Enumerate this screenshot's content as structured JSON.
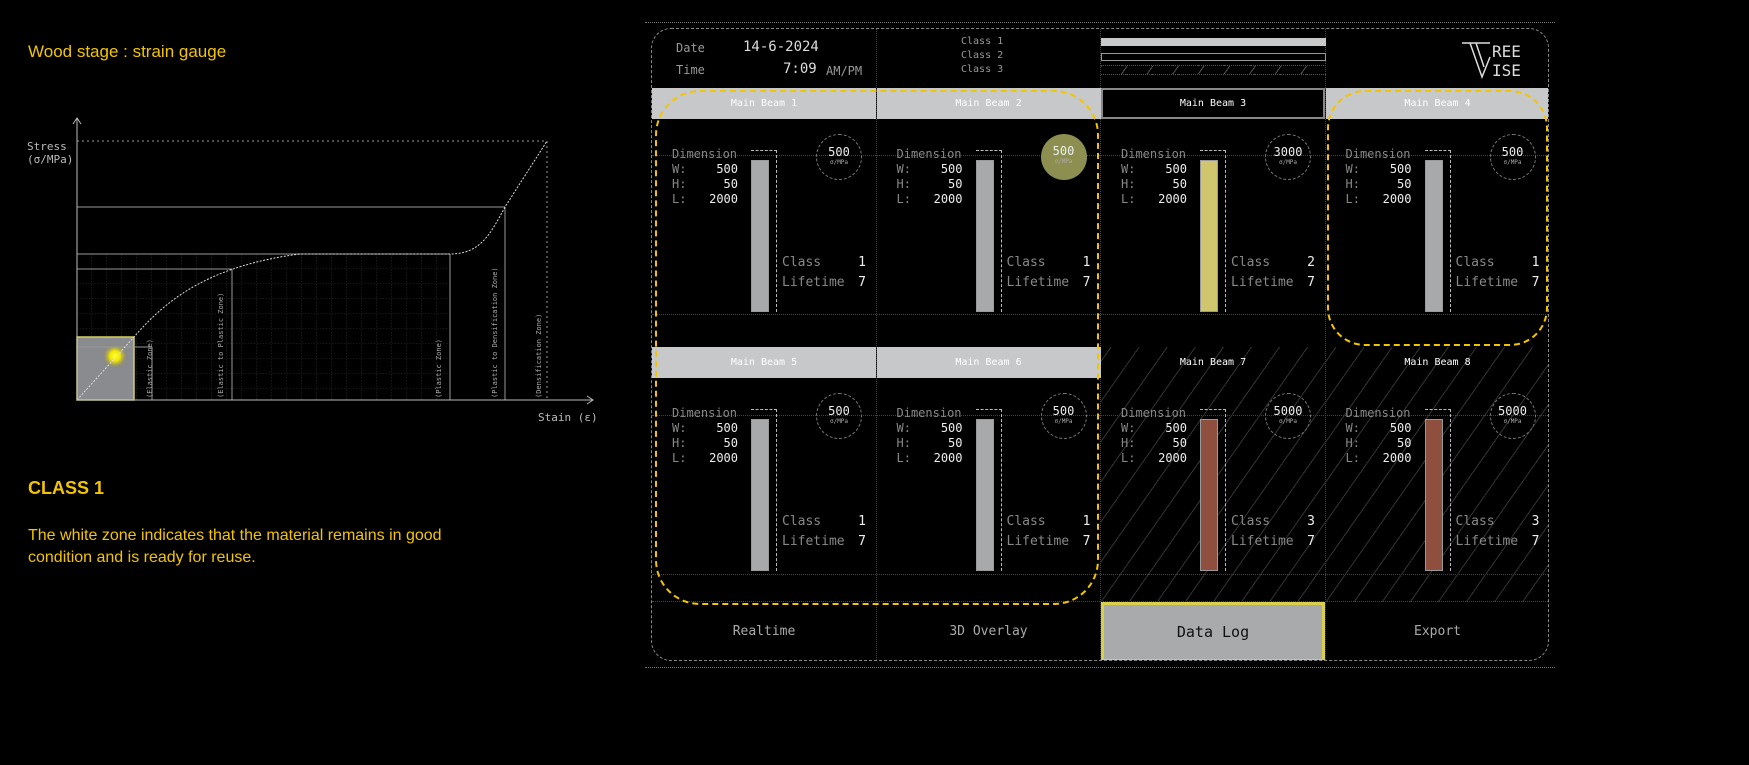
{
  "left": {
    "title": "Wood stage :  strain gauge",
    "diagram": {
      "y_axis_label_1": "Stress",
      "y_axis_label_2": "(σ/MPa)",
      "x_axis_label": "Stain (ε)",
      "zones": [
        "(Elastic Zone)",
        "(Elastic to Plastic Zone)",
        "(Plastic Zone)",
        "(Plastic to Densification Zone)",
        "(Densification Zone)"
      ],
      "highlight_color": "#f2e600"
    },
    "class_title": "CLASS 1",
    "description": "The white zone indicates that the material remains in good condition and is ready for reuse."
  },
  "header": {
    "date_label": "Date",
    "date_value": "14-6-2024",
    "time_label": "Time",
    "time_value": "7:09",
    "time_suffix": "AM/PM",
    "legend": [
      "Class 1",
      "Class 2",
      "Class 3"
    ],
    "logo_text": "TREE WISE"
  },
  "card_labels": {
    "dimension": "Dimension",
    "w": "W:",
    "h": "H:",
    "l": "L:",
    "class": "Class",
    "lifetime": "Lifetime",
    "unit": "σ/MPa"
  },
  "beams": [
    {
      "name": "Main Beam 1",
      "w": "500",
      "h": "50",
      "l": "2000",
      "stress": "500",
      "class": "1",
      "lifetime": "7"
    },
    {
      "name": "Main Beam 2",
      "w": "500",
      "h": "50",
      "l": "2000",
      "stress": "500",
      "class": "1",
      "lifetime": "7"
    },
    {
      "name": "Main Beam 3",
      "w": "500",
      "h": "50",
      "l": "2000",
      "stress": "3000",
      "class": "2",
      "lifetime": "7"
    },
    {
      "name": "Main Beam 4",
      "w": "500",
      "h": "50",
      "l": "2000",
      "stress": "500",
      "class": "1",
      "lifetime": "7"
    },
    {
      "name": "Main Beam 5",
      "w": "500",
      "h": "50",
      "l": "2000",
      "stress": "500",
      "class": "1",
      "lifetime": "7"
    },
    {
      "name": "Main Beam 6",
      "w": "500",
      "h": "50",
      "l": "2000",
      "stress": "500",
      "class": "1",
      "lifetime": "7"
    },
    {
      "name": "Main Beam 7",
      "w": "500",
      "h": "50",
      "l": "2000",
      "stress": "5000",
      "class": "3",
      "lifetime": "7"
    },
    {
      "name": "Main Beam 8",
      "w": "500",
      "h": "50",
      "l": "2000",
      "stress": "5000",
      "class": "3",
      "lifetime": "7"
    }
  ],
  "class_colors": {
    "1": "#a8a9ab",
    "2": "#cfc66e",
    "3": "#8f4f3e"
  },
  "selection_color": "#f2c500",
  "buttons": [
    {
      "label": "Realtime",
      "active": false
    },
    {
      "label": "3D Overlay",
      "active": false
    },
    {
      "label": "Data Log",
      "active": true
    },
    {
      "label": "Export",
      "active": false
    }
  ]
}
